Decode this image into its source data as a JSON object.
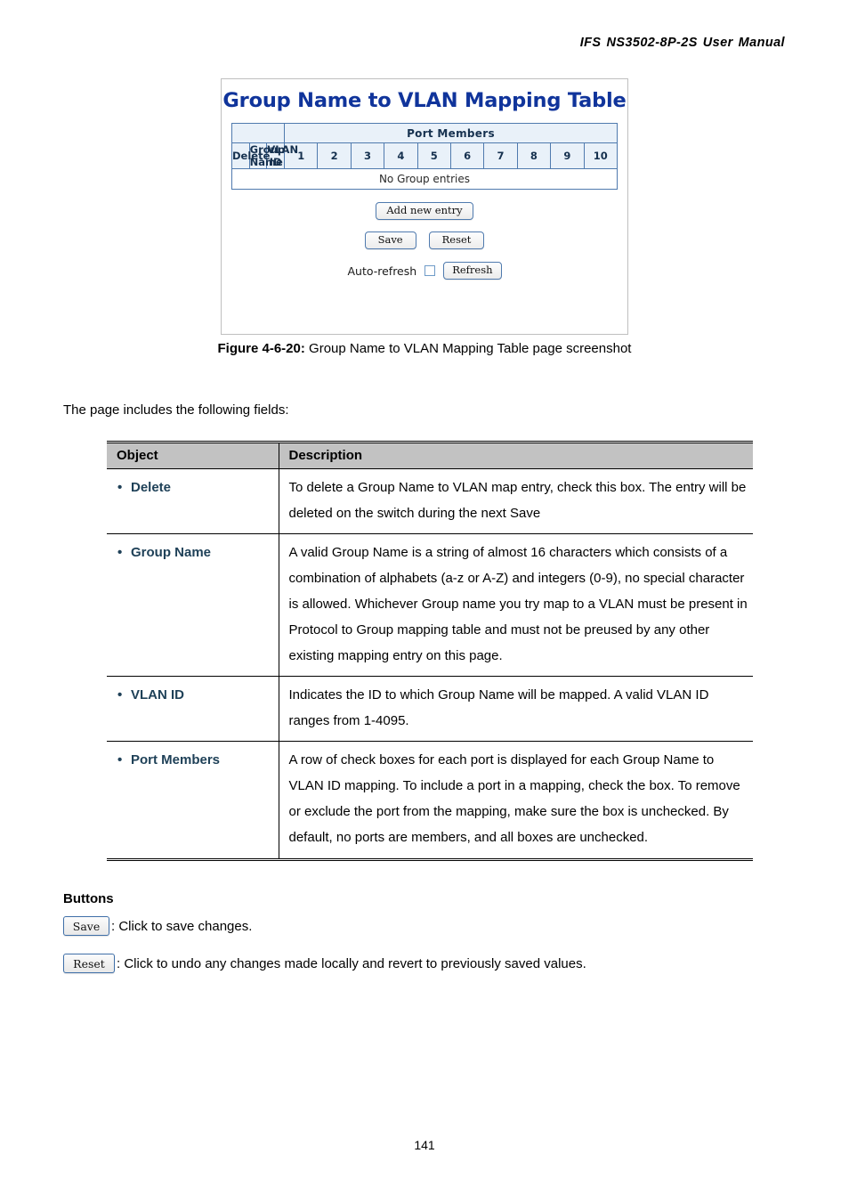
{
  "header": {
    "parts": [
      "IFS",
      "NS3502-8P-2S",
      "User",
      "Manual"
    ]
  },
  "figure": {
    "app_title": "Group Name to VLAN Mapping Table",
    "table": {
      "group_header": "Port Members",
      "columns": [
        "Delete",
        "Group Name",
        "VLAN ID"
      ],
      "ports": [
        "1",
        "2",
        "3",
        "4",
        "5",
        "6",
        "7",
        "8",
        "9",
        "10"
      ],
      "empty_message": "No Group entries"
    },
    "buttons": {
      "add_new_entry": "Add new entry",
      "save": "Save",
      "reset": "Reset",
      "refresh": "Refresh"
    },
    "auto_refresh_label": "Auto-refresh",
    "auto_refresh_checked": false
  },
  "caption": {
    "number": "Figure 4-6-20:",
    "text": "Group Name to VLAN Mapping Table page screenshot"
  },
  "lead_paragraph": "The page includes the following fields:",
  "desc_table": {
    "headers": {
      "object": "Object",
      "description": "Description"
    },
    "rows": [
      {
        "object": "Delete",
        "description": "To delete a Group Name to VLAN map entry, check this box. The entry will be deleted on the switch during the next Save"
      },
      {
        "object": "Group Name",
        "description": "A valid Group Name is a string of almost 16 characters which consists of a combination of alphabets (a-z or A-Z) and integers (0-9), no special character is allowed. Whichever Group name you try map to a VLAN must be present in Protocol to Group mapping table and must not be preused by any other existing mapping entry on this page."
      },
      {
        "object": "VLAN ID",
        "description": "Indicates the ID to which Group Name will be mapped. A valid VLAN ID ranges from 1-4095."
      },
      {
        "object": "Port Members",
        "description": "A row of check boxes for each port is displayed for each Group Name to VLAN ID mapping. To include a port in a mapping, check the box. To remove or exclude the port from the mapping, make sure the box is unchecked. By default, no ports are members, and all boxes are unchecked."
      }
    ]
  },
  "buttons_section": {
    "heading": "Buttons",
    "items": [
      {
        "label": "Save",
        "description": ": Click to save changes."
      },
      {
        "label": "Reset",
        "description": ": Click to undo any changes made locally and revert to previously saved values."
      }
    ]
  },
  "page_number": "141",
  "colors": {
    "app_title": "#10349B",
    "table_header_bg": "#e9f1f9",
    "table_border": "#4f7aae",
    "desc_header_bg": "#c2c2c2",
    "object_label": "#1f4158"
  }
}
